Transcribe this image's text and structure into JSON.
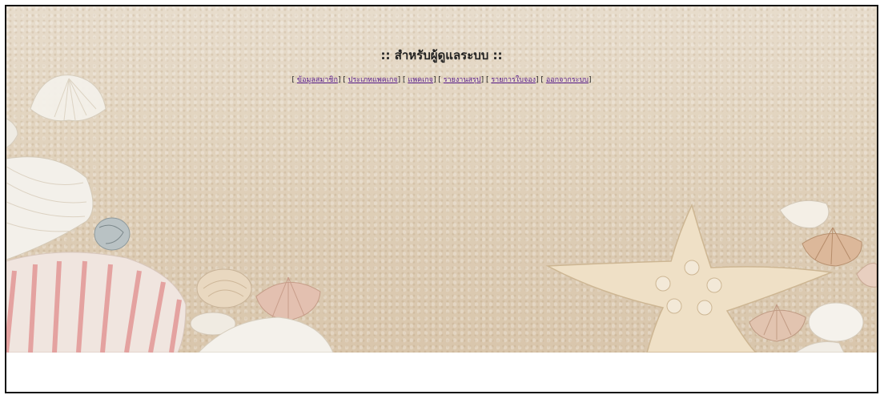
{
  "header": {
    "title": ":: สำหรับผู้ดูแลระบบ ::"
  },
  "nav": {
    "open": "[",
    "close": "]",
    "items": [
      {
        "label": "ข้อมูลสมาชิก"
      },
      {
        "label": "ประเภทแพคเกจ"
      },
      {
        "label": "แพคเกจ"
      },
      {
        "label": "รายงานสรุป"
      },
      {
        "label": "รายการใบจอง"
      },
      {
        "label": "ออกจากระบบ"
      }
    ]
  },
  "colors": {
    "sand": "#e2d4bf",
    "link": "#551a8b",
    "border": "#111111"
  },
  "banner": {
    "image": "beach-sand-shells-starfish"
  }
}
